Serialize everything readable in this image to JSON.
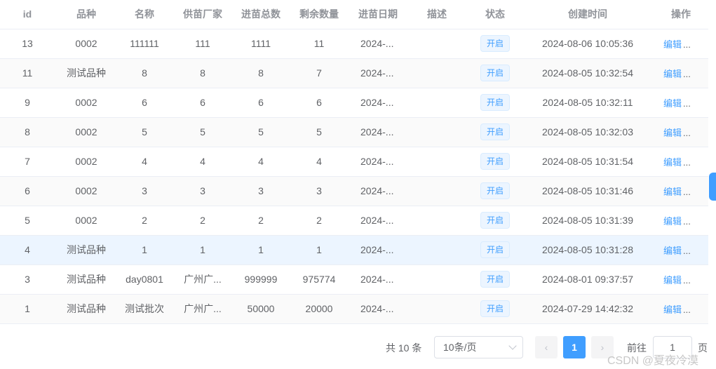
{
  "table": {
    "columns": [
      "id",
      "品种",
      "名称",
      "供苗厂家",
      "进苗总数",
      "剩余数量",
      "进苗日期",
      "描述",
      "状态",
      "创建时间",
      "操作"
    ],
    "rows": [
      {
        "id": "13",
        "variety": "0002",
        "name": "111111",
        "supplier": "111",
        "total": "1111",
        "remaining": "11",
        "date": "2024-...",
        "desc": "",
        "status": "开启",
        "created": "2024-08-06 10:05:36"
      },
      {
        "id": "11",
        "variety": "测试品种",
        "name": "8",
        "supplier": "8",
        "total": "8",
        "remaining": "7",
        "date": "2024-...",
        "desc": "",
        "status": "开启",
        "created": "2024-08-05 10:32:54"
      },
      {
        "id": "9",
        "variety": "0002",
        "name": "6",
        "supplier": "6",
        "total": "6",
        "remaining": "6",
        "date": "2024-...",
        "desc": "",
        "status": "开启",
        "created": "2024-08-05 10:32:11"
      },
      {
        "id": "8",
        "variety": "0002",
        "name": "5",
        "supplier": "5",
        "total": "5",
        "remaining": "5",
        "date": "2024-...",
        "desc": "",
        "status": "开启",
        "created": "2024-08-05 10:32:03"
      },
      {
        "id": "7",
        "variety": "0002",
        "name": "4",
        "supplier": "4",
        "total": "4",
        "remaining": "4",
        "date": "2024-...",
        "desc": "",
        "status": "开启",
        "created": "2024-08-05 10:31:54"
      },
      {
        "id": "6",
        "variety": "0002",
        "name": "3",
        "supplier": "3",
        "total": "3",
        "remaining": "3",
        "date": "2024-...",
        "desc": "",
        "status": "开启",
        "created": "2024-08-05 10:31:46"
      },
      {
        "id": "5",
        "variety": "0002",
        "name": "2",
        "supplier": "2",
        "total": "2",
        "remaining": "2",
        "date": "2024-...",
        "desc": "",
        "status": "开启",
        "created": "2024-08-05 10:31:39"
      },
      {
        "id": "4",
        "variety": "测试品种",
        "name": "1",
        "supplier": "1",
        "total": "1",
        "remaining": "1",
        "date": "2024-...",
        "desc": "",
        "status": "开启",
        "created": "2024-08-05 10:31:28"
      },
      {
        "id": "3",
        "variety": "测试品种",
        "name": "day0801",
        "supplier": "广州广...",
        "total": "999999",
        "remaining": "975774",
        "date": "2024-...",
        "desc": "",
        "status": "开启",
        "created": "2024-08-01 09:37:57"
      },
      {
        "id": "1",
        "variety": "测试品种",
        "name": "测试批次",
        "supplier": "广州广...",
        "total": "50000",
        "remaining": "20000",
        "date": "2024-...",
        "desc": "",
        "status": "开启",
        "created": "2024-07-29 14:42:32"
      }
    ],
    "edit_label": "编辑",
    "more_label": "...",
    "hovered_row": 7
  },
  "pagination": {
    "total_text": "共 10 条",
    "page_size": "10条/页",
    "prev_icon": "chevron-left-icon",
    "next_icon": "chevron-right-icon",
    "current_page": "1",
    "jump_label": "前往",
    "jump_value": "1",
    "page_unit": "页"
  },
  "watermark": "CSDN @夏夜冷漠",
  "colors": {
    "accent": "#409eff",
    "tag_bg": "#ecf5ff",
    "stripe": "#fafafa",
    "hover": "#ecf5ff"
  }
}
